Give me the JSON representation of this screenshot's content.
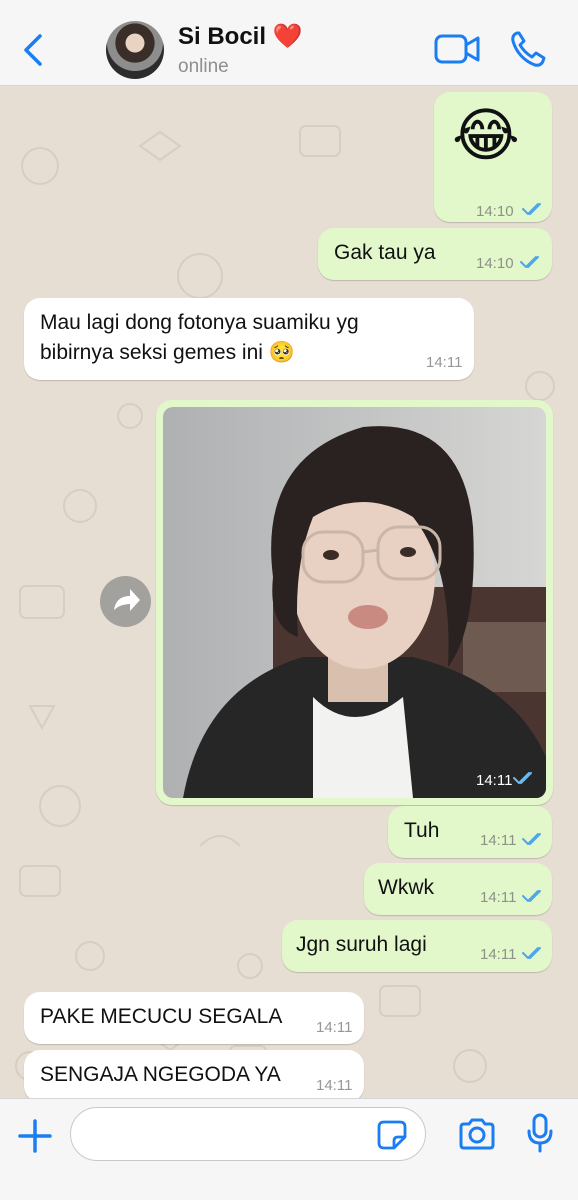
{
  "header": {
    "back_icon": "chevron-left-icon",
    "contact_name": "Si Bocil",
    "contact_emoji": "❤️",
    "status": "online",
    "video_icon": "video-camera-icon",
    "call_icon": "phone-icon"
  },
  "messages": [
    {
      "direction": "out",
      "text": "😂",
      "time": "14:10",
      "read": true
    },
    {
      "direction": "out",
      "text": "Gak tau ya",
      "time": "14:10",
      "read": true
    },
    {
      "direction": "in",
      "text_line1": "Mau lagi dong fotonya suamiku yg",
      "text_line2": "bibirnya seksi gemes ini 🥺",
      "time": "14:11"
    },
    {
      "direction": "out",
      "type": "photo",
      "time": "14:11",
      "read": true
    },
    {
      "direction": "out",
      "text": "Tuh",
      "time": "14:11",
      "read": true
    },
    {
      "direction": "out",
      "text": "Wkwk",
      "time": "14:11",
      "read": true
    },
    {
      "direction": "out",
      "text": "Jgn suruh lagi",
      "time": "14:11",
      "read": true
    },
    {
      "direction": "in",
      "text": "PAKE MECUCU SEGALA",
      "time": "14:11"
    },
    {
      "direction": "in",
      "text": "SENGAJA NGEGODA YA",
      "time": "14:11"
    }
  ],
  "input": {
    "placeholder": "",
    "plus_icon": "plus-icon",
    "sticker_icon": "sticker-icon",
    "camera_icon": "camera-icon",
    "mic_icon": "microphone-icon"
  },
  "colors": {
    "accent": "#1a7df2",
    "outgoing_bubble": "#e2f8cb",
    "incoming_bubble": "#ffffff",
    "read_ticks": "#4fa7e8",
    "chat_background": "#e7ded3"
  }
}
